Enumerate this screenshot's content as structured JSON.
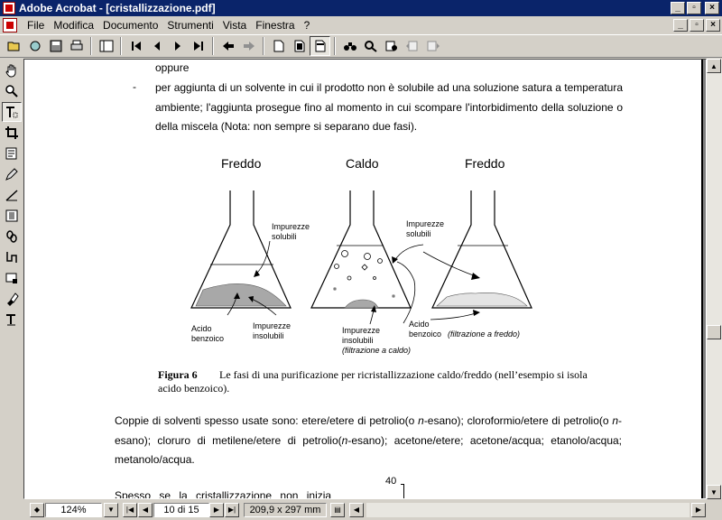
{
  "window": {
    "title": "Adobe Acrobat - [cristallizzazione.pdf]",
    "minimize": "_",
    "restore": "▫",
    "close": "×"
  },
  "menu": {
    "items": [
      "File",
      "Modifica",
      "Documento",
      "Strumenti",
      "Vista",
      "Finestra",
      "?"
    ]
  },
  "document": {
    "line_oppure": "oppure",
    "bullet_dash": "-",
    "bullet_text": "per aggiunta di un solvente in cui il prodotto non è solubile ad una soluzione satura a temperatura ambiente; l'aggiunta prosegue fino al momento in cui scompare l'intorbidimento della soluzione o della miscela (Nota: non sempre si separano due fasi).",
    "figure": {
      "heading_1": "Freddo",
      "heading_2": "Caldo",
      "heading_3": "Freddo",
      "label_impurezze_solubili_1a": "Impurezze",
      "label_impurezze_solubili_1b": "solubili",
      "label_acido_1a": "Acido",
      "label_acido_1b": "benzoico",
      "label_imp_insol_1a": "Impurezze",
      "label_imp_insol_1b": "insolubili",
      "label_imp_sol_2a": "Impurezze",
      "label_imp_sol_2b": "solubili",
      "label_imp_insol_2a": "Impurezze",
      "label_imp_insol_2b": "insolubili",
      "label_filtr_caldo": "(filtrazione a caldo)",
      "label_acido_2a": "Acido",
      "label_acido_2b": "benzoico",
      "label_filtr_freddo": "(filtrazione a freddo)"
    },
    "caption_label": "Figura 6",
    "caption_text": "Le fasi di una purificazione per ricristallizzazione caldo/freddo (nell’esempio si isola acido benzoico).",
    "para_coppie_1": "Coppie di solventi spesso usate sono: etere/etere di petrolio(o ",
    "para_coppie_n1": "n",
    "para_coppie_2": "-esano); cloroformio/etere di petrolio(o ",
    "para_coppie_n2": "n",
    "para_coppie_3": "-esano); cloruro di metilene/etere di petrolio(",
    "para_coppie_n3": "n",
    "para_coppie_4": "-esano); acetone/etere; acetone/acqua; etanolo/acqua; metanolo/acqua.",
    "page_number": "40",
    "line_spesso": "Spesso se la cristallizzazione non inizia"
  },
  "status": {
    "zoom": "124%",
    "page": "10 di 15",
    "size": "209,9 x 297 mm"
  }
}
